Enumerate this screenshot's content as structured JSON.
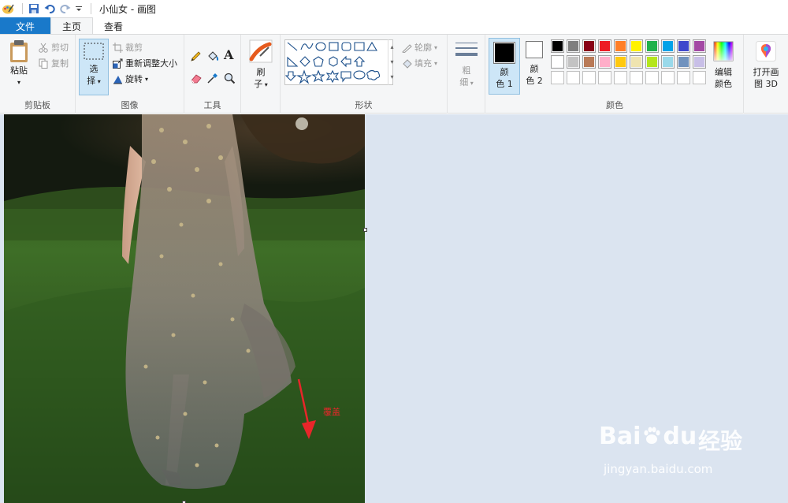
{
  "window": {
    "title": "小仙女 - 画图"
  },
  "tabs": [
    {
      "label": "文件"
    },
    {
      "label": "主页"
    },
    {
      "label": "查看"
    }
  ],
  "clipboard": {
    "paste_label": "粘贴",
    "cut_label": "剪切",
    "copy_label": "复制",
    "group_label": "剪贴板"
  },
  "image_group": {
    "select_label_1": "选",
    "select_label_2": "择",
    "crop_label": "裁剪",
    "resize_label": "重新调整大小",
    "rotate_label": "旋转",
    "group_label": "图像"
  },
  "tools": {
    "group_label": "工具",
    "text_glyph": "A"
  },
  "brushes": {
    "label_1": "刷",
    "label_2": "子"
  },
  "shapes": {
    "outline_label": "轮廓",
    "fill_label": "填充",
    "group_label": "形状"
  },
  "size": {
    "label_1": "粗",
    "label_2": "细"
  },
  "colors": {
    "color1_label_1": "颜",
    "color1_label_2": "色 1",
    "color2_label_1": "颜",
    "color2_label_2": "色 2",
    "edit_label_1": "编辑",
    "edit_label_2": "颜色",
    "paint3d_label_1": "打开画",
    "paint3d_label_2": "图 3D",
    "group_label": "颜色",
    "color1": "#000000",
    "color2": "#ffffff",
    "palette_row1": [
      "#000000",
      "#7f7f7f",
      "#880015",
      "#ed1c24",
      "#ff7f27",
      "#fff200",
      "#22b14c",
      "#00a2e8",
      "#3f48cc",
      "#a349a4"
    ],
    "palette_row2": [
      "#ffffff",
      "#c3c3c3",
      "#b97a57",
      "#ffaec9",
      "#ffc90e",
      "#efe4b0",
      "#b5e61d",
      "#99d9ea",
      "#7092be",
      "#c8bfe7"
    ]
  },
  "canvas": {
    "annotation_text": "覆盖",
    "annotation_color": "#e8262a"
  },
  "watermark": {
    "brand_text": "Bai",
    "brand_text_2": "du",
    "brand_cn": "经验",
    "url": "jingyan.baidu.com"
  }
}
